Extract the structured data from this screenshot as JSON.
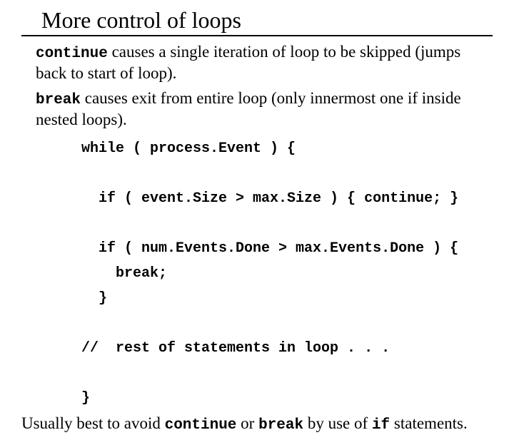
{
  "title": "More control of loops",
  "para1": {
    "kw": "continue",
    "text": " causes a single iteration of loop to be skipped (jumps back to start of loop)."
  },
  "para2": {
    "kw": "break",
    "text": " causes exit from entire loop  (only innermost one if inside nested loops)."
  },
  "code": "while ( process.Event ) {\n\n  if ( event.Size > max.Size ) { continue; }\n\n  if ( num.Events.Done > max.Events.Done ) {\n    break;\n  }\n\n//  rest of statements in loop . . .\n\n}",
  "footer": {
    "pre": "Usually best to avoid ",
    "kw1": "continue",
    "mid": " or ",
    "kw2": "break",
    "post1": " by use of ",
    "kw3": "if",
    "post2": " statements."
  }
}
